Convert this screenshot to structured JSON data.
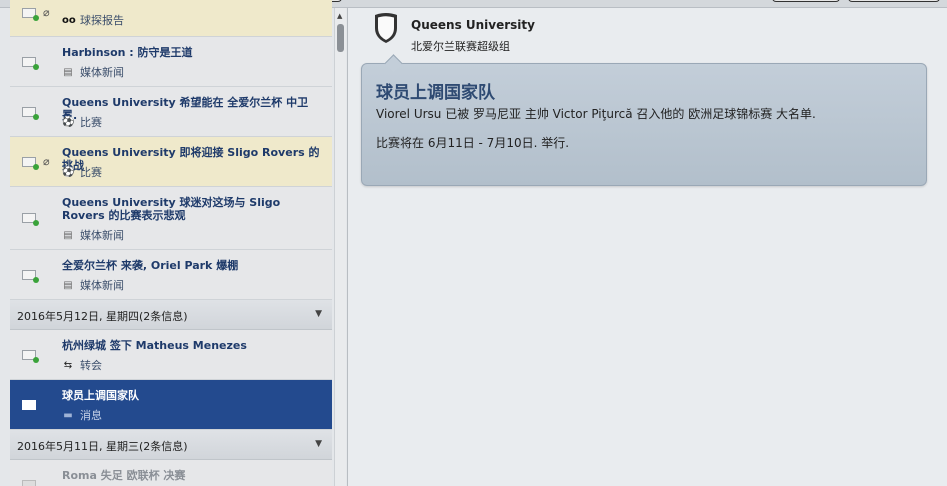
{
  "messages": [
    {
      "title": "",
      "category": "球探报告",
      "icon": "binoculars-icon",
      "attachment": true,
      "unread": true
    },
    {
      "title": "Harbinson : 防守是王道",
      "category": "媒体新闻",
      "icon": "newspaper-icon",
      "unread": true
    },
    {
      "title": "Queens University 希望能在 全爱尔兰杯 中卫冕.",
      "category": "比赛",
      "icon": "football-icon",
      "unread": true
    },
    {
      "title": "Queens University 即将迎接 Sligo Rovers 的挑战",
      "category": "比赛",
      "icon": "football-icon",
      "attachment": true,
      "unread": true
    },
    {
      "title": "Queens University 球迷对这场与 Sligo Rovers 的比赛表示悲观",
      "category": "媒体新闻",
      "icon": "newspaper-icon",
      "unread": true
    },
    {
      "title": "全爱尔兰杯 来袭, Oriel Park 爆棚",
      "category": "媒体新闻",
      "icon": "newspaper-icon",
      "unread": true
    },
    {
      "title": "杭州绿城 签下 Matheus Menezes",
      "category": "转会",
      "icon": "transfer-icon",
      "unread": true
    },
    {
      "title": "球员上调国家队",
      "category": "消息",
      "icon": "speech-bubble-icon",
      "selected": true
    },
    {
      "title": "Roma 失足 欧联杯 决赛",
      "category": "",
      "icon": "",
      "read": true
    }
  ],
  "date_headers": [
    "2016年5月12日, 星期四(2条信息)",
    "2016年5月11日, 星期三(2条信息)"
  ],
  "detail": {
    "club": "Queens University",
    "league": "北爱尔兰联赛超级组",
    "title": "球员上调国家队",
    "line1": "Viorel Ursu 已被 罗马尼亚 主帅 Victor Piţurcă 召入他的 欧洲足球锦标赛 大名单.",
    "line2": "比赛将在  6月11日 - 7月10日. 举行."
  },
  "colors": {
    "selected": "#234a8e",
    "highlight": "#efe9cb",
    "bubble": "#b8c4cf"
  }
}
